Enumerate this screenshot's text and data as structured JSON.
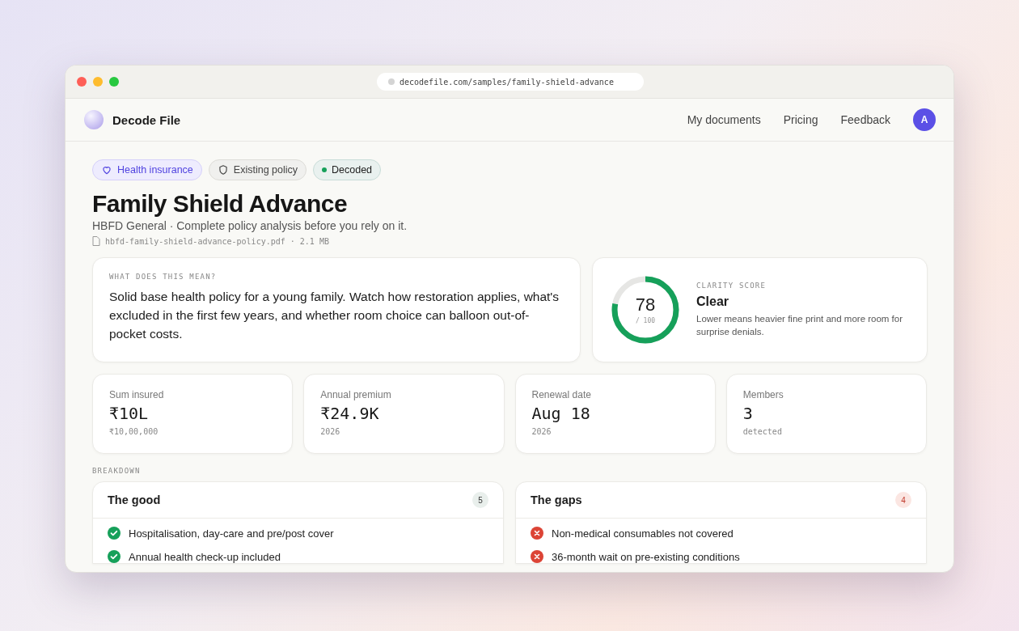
{
  "browser": {
    "url": "decodefile.com/samples/family-shield-advance"
  },
  "nav": {
    "brand": "Decode File",
    "links": [
      "My documents",
      "Pricing",
      "Feedback"
    ],
    "avatar": "A"
  },
  "tags": [
    {
      "label": "Health insurance",
      "kind": "health"
    },
    {
      "label": "Existing policy",
      "kind": "policy"
    },
    {
      "label": "Decoded",
      "kind": "status"
    }
  ],
  "title": "Family Shield Advance",
  "subtitle": "HBFD General · Complete policy analysis before you rely on it.",
  "file": "hbfd-family-shield-advance-policy.pdf · 2.1 MB",
  "summary": {
    "label": "WHAT DOES THIS MEAN?",
    "text": "Solid base health policy for a young family. Watch how restoration applies, what's excluded in the first few years, and whether room choice can balloon out-of-pocket costs."
  },
  "clarity": {
    "score": "78",
    "max": "/ 100",
    "level": 0.78,
    "label": "CLARITY SCORE",
    "verdict": "Clear",
    "note": "Lower means heavier fine print and more room for surprise denials."
  },
  "stats": [
    {
      "label": "Sum insured",
      "value": "₹10L",
      "sub": "₹10,00,000"
    },
    {
      "label": "Annual premium",
      "value": "₹24.9K",
      "sub": "2026"
    },
    {
      "label": "Renewal date",
      "value": "Aug 18",
      "sub": "2026"
    },
    {
      "label": "Members",
      "value": "3",
      "sub": "detected"
    }
  ],
  "breakdown_label": "BREAKDOWN",
  "panels": [
    {
      "title": "The good",
      "count": "5",
      "kind": "good",
      "items": [
        "Hospitalisation, day-care and pre/post cover",
        "Annual health check-up included"
      ]
    },
    {
      "title": "The gaps",
      "count": "4",
      "kind": "gap",
      "items": [
        "Non-medical consumables not covered",
        "36-month wait on pre-existing conditions"
      ]
    }
  ]
}
